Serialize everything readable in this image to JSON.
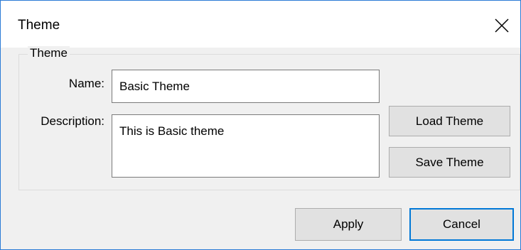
{
  "window": {
    "title": "Theme"
  },
  "icons": {
    "close": "close-icon"
  },
  "group": {
    "legend": "Theme",
    "name_label": "Name:",
    "name_value": "Basic Theme",
    "description_label": "Description:",
    "description_value": "This is Basic theme"
  },
  "buttons": {
    "load": "Load Theme",
    "save": "Save Theme",
    "apply": "Apply",
    "cancel": "Cancel"
  },
  "colors": {
    "accent": "#0078d7",
    "window_border": "#2b7bd6"
  }
}
